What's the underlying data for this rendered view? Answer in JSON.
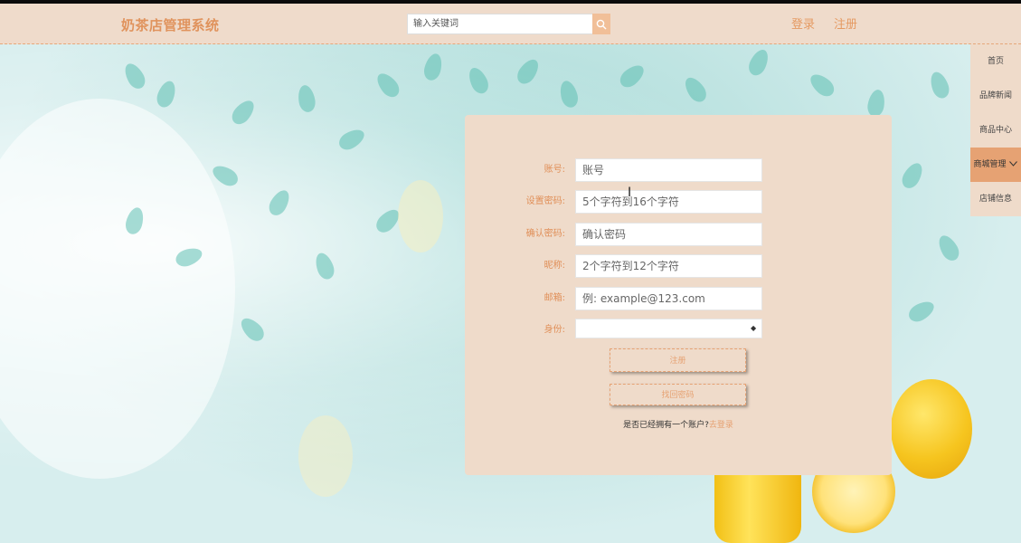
{
  "header": {
    "logo": "奶茶店管理系统",
    "search_placeholder": "输入关键词",
    "search_icon": "search-icon",
    "login": "登录",
    "register": "注册"
  },
  "sidebar": {
    "items": [
      {
        "label": "首页",
        "active": false
      },
      {
        "label": "品牌新闻",
        "active": false
      },
      {
        "label": "商品中心",
        "active": false
      },
      {
        "label": "商城管理",
        "active": true,
        "icon": "chevron-down-icon"
      },
      {
        "label": "店铺信息",
        "active": false
      }
    ]
  },
  "form": {
    "fields": [
      {
        "label": "账号:",
        "placeholder": "账号"
      },
      {
        "label": "设置密码:",
        "placeholder": "5个字符到16个字符"
      },
      {
        "label": "确认密码:",
        "placeholder": "确认密码"
      },
      {
        "label": "昵称:",
        "placeholder": "2个字符到12个字符"
      },
      {
        "label": "邮箱:",
        "placeholder": "例: example@123.com"
      },
      {
        "label": "身份:",
        "value": ""
      }
    ],
    "register_button": "注册",
    "find_password_button": "找回密码",
    "login_prompt": "是否已经拥有一个账户?",
    "login_link": "去登录"
  },
  "colors": {
    "accent": "#e6a273",
    "panel": "#efdbca",
    "header_bg": "#efdbcb",
    "logo": "#e0935d"
  }
}
